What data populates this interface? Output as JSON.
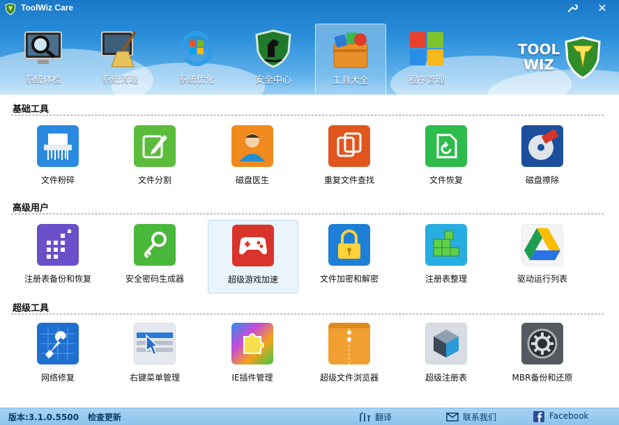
{
  "window": {
    "title": "ToolWiz Care",
    "settings_icon": "wrench-icon",
    "close_icon": "close-icon",
    "close_glyph": "✕"
  },
  "nav": {
    "items": [
      {
        "label": "系统体检",
        "icon": "magnifier-icon"
      },
      {
        "label": "系统清理",
        "icon": "broom-icon"
      },
      {
        "label": "系统优化",
        "icon": "windows-refresh-icon"
      },
      {
        "label": "安全中心",
        "icon": "horse-shield-icon"
      },
      {
        "label": "工具大全",
        "icon": "toolbox-icon",
        "active": true
      },
      {
        "label": "程序管理",
        "icon": "windows-tiles-icon"
      }
    ]
  },
  "logo": {
    "line1": "TOOL",
    "line2": "WIZ"
  },
  "sections": [
    {
      "title": "基础工具",
      "tools": [
        {
          "label": "文件粉碎",
          "icon": "shredder-icon",
          "color": "#2a8ae0"
        },
        {
          "label": "文件分割",
          "icon": "edit-split-icon",
          "color": "#5bbc3c"
        },
        {
          "label": "磁盘医生",
          "icon": "doctor-icon",
          "color": "#f08a1e"
        },
        {
          "label": "重复文件查找",
          "icon": "duplicate-files-icon",
          "color": "#e0561e"
        },
        {
          "label": "文件恢复",
          "icon": "file-restore-icon",
          "color": "#2dbb4c"
        },
        {
          "label": "磁盘擦除",
          "icon": "disk-eraser-icon",
          "color": "#1c4f9c"
        }
      ]
    },
    {
      "title": "高级用户",
      "tools": [
        {
          "label": "注册表备份和恢复",
          "icon": "registry-grid-icon",
          "color": "#6a4fc8"
        },
        {
          "label": "安全密码生成器",
          "icon": "key-icon",
          "color": "#49b83a"
        },
        {
          "label": "超级游戏加速",
          "icon": "gamepad-icon",
          "color": "#d8342b",
          "selected": true
        },
        {
          "label": "文件加密和解密",
          "icon": "lock-icon",
          "color": "#1e7fd6"
        },
        {
          "label": "注册表整理",
          "icon": "cubes-icon",
          "color": "#27aee0"
        },
        {
          "label": "驱动运行列表",
          "icon": "drive-triangle-icon",
          "color": "#ffffff"
        }
      ]
    },
    {
      "title": "超级工具",
      "tools": [
        {
          "label": "网络修复",
          "icon": "network-wrench-icon",
          "color": "#1f6fd0"
        },
        {
          "label": "右键菜单管理",
          "icon": "cursor-menu-icon",
          "color": "#e5e8ee"
        },
        {
          "label": "IE插件管理",
          "icon": "puzzle-icon",
          "color": "#c84cd8"
        },
        {
          "label": "超级文件浏览器",
          "icon": "folder-icon",
          "color": "#f0a030"
        },
        {
          "label": "超级注册表",
          "icon": "registry-cube-icon",
          "color": "#d9dde3"
        },
        {
          "label": "MBR备份和还原",
          "icon": "gear-icon",
          "color": "#555a60"
        }
      ]
    }
  ],
  "status": {
    "version": "版本:3.1.0.5500",
    "check_update": "检查更新",
    "translate": "翻译",
    "contact": "联系我们",
    "facebook": "Facebook"
  }
}
